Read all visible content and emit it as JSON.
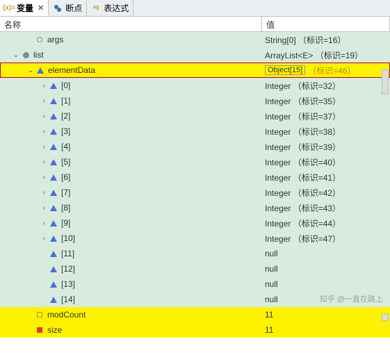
{
  "tabs": [
    {
      "label": "变量",
      "active": true,
      "iconColor": "#c59a3a"
    },
    {
      "label": "断点",
      "active": false,
      "iconColor": "#2a7ab0"
    },
    {
      "label": "表达式",
      "active": false,
      "iconColor": "#c59a3a"
    }
  ],
  "columns": {
    "name": "名称",
    "value": "值"
  },
  "rows": [
    {
      "indent": 1,
      "expander": "none",
      "icon": "circle-o",
      "name": "args",
      "value": "String[0]  （标识=16）",
      "bg": "normal"
    },
    {
      "indent": 0,
      "expander": "open",
      "icon": "circle-f",
      "name": "list",
      "value": "ArrayList<E>  （标识=19）",
      "bg": "normal"
    },
    {
      "indent": 1,
      "expander": "open",
      "icon": "triangle",
      "name": "elementData",
      "value": "Object[15] ",
      "valueExtra": "（标识=46）",
      "bg": "yellow",
      "selected": true
    },
    {
      "indent": 2,
      "expander": "close",
      "icon": "triangle",
      "name": "[0]",
      "value": "Integer  （标识=32）",
      "bg": "normal"
    },
    {
      "indent": 2,
      "expander": "close",
      "icon": "triangle",
      "name": "[1]",
      "value": "Integer  （标识=35）",
      "bg": "normal"
    },
    {
      "indent": 2,
      "expander": "close",
      "icon": "triangle",
      "name": "[2]",
      "value": "Integer  （标识=37）",
      "bg": "normal"
    },
    {
      "indent": 2,
      "expander": "close",
      "icon": "triangle",
      "name": "[3]",
      "value": "Integer  （标识=38）",
      "bg": "normal"
    },
    {
      "indent": 2,
      "expander": "close",
      "icon": "triangle",
      "name": "[4]",
      "value": "Integer  （标识=39）",
      "bg": "normal"
    },
    {
      "indent": 2,
      "expander": "close",
      "icon": "triangle",
      "name": "[5]",
      "value": "Integer  （标识=40）",
      "bg": "normal"
    },
    {
      "indent": 2,
      "expander": "close",
      "icon": "triangle",
      "name": "[6]",
      "value": "Integer  （标识=41）",
      "bg": "normal"
    },
    {
      "indent": 2,
      "expander": "close",
      "icon": "triangle",
      "name": "[7]",
      "value": "Integer  （标识=42）",
      "bg": "normal"
    },
    {
      "indent": 2,
      "expander": "close",
      "icon": "triangle",
      "name": "[8]",
      "value": "Integer  （标识=43）",
      "bg": "normal"
    },
    {
      "indent": 2,
      "expander": "close",
      "icon": "triangle",
      "name": "[9]",
      "value": "Integer  （标识=44）",
      "bg": "normal"
    },
    {
      "indent": 2,
      "expander": "close",
      "icon": "triangle",
      "name": "[10]",
      "value": "Integer  （标识=47）",
      "bg": "normal"
    },
    {
      "indent": 2,
      "expander": "none",
      "icon": "triangle",
      "name": "[11]",
      "value": "null",
      "bg": "normal"
    },
    {
      "indent": 2,
      "expander": "none",
      "icon": "triangle",
      "name": "[12]",
      "value": "null",
      "bg": "normal"
    },
    {
      "indent": 2,
      "expander": "none",
      "icon": "triangle",
      "name": "[13]",
      "value": "null",
      "bg": "normal"
    },
    {
      "indent": 2,
      "expander": "none",
      "icon": "triangle",
      "name": "[14]",
      "value": "null",
      "bg": "normal"
    },
    {
      "indent": 1,
      "expander": "none",
      "icon": "square-o",
      "name": "modCount",
      "value": "11",
      "bg": "yellow"
    },
    {
      "indent": 1,
      "expander": "none",
      "icon": "square-r",
      "name": "size",
      "value": "11",
      "bg": "yellow"
    }
  ],
  "watermark": "知乎 @一直在路上"
}
